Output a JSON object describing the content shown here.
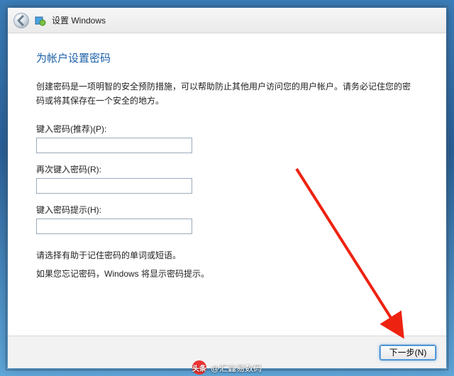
{
  "titlebar": {
    "back_icon": "back-arrow",
    "app_icon": "windows-oobe-icon",
    "title": "设置 Windows"
  },
  "page": {
    "heading": "为帐户设置密码",
    "description": "创建密码是一项明智的安全预防措施，可以帮助防止其他用户访问您的用户帐户。请务必记住您的密码或将其保存在一个安全的地方。",
    "fields": {
      "password": {
        "label": "键入密码(推荐)(P):",
        "value": ""
      },
      "confirm": {
        "label": "再次键入密码(R):",
        "value": ""
      },
      "hint": {
        "label": "键入密码提示(H):",
        "value": ""
      }
    },
    "hint_line1": "请选择有助于记住密码的单词或短语。",
    "hint_line2": "如果您忘记密码，Windows 将显示密码提示。"
  },
  "footer": {
    "next": "下一步(N)"
  },
  "watermark": {
    "logo_text": "头条",
    "text": "@汇鑫易数码"
  },
  "annotation": {
    "arrow": "red-arrow-pointing-to-next"
  }
}
